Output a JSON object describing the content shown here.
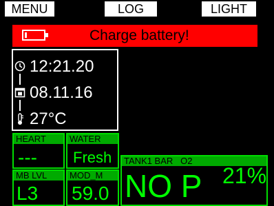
{
  "softkeys": {
    "menu": "MENU",
    "log": "LOG",
    "light": "LIGHT"
  },
  "alert": {
    "message": "Charge battery!",
    "icon": "battery-low-icon",
    "color": "#ff0000"
  },
  "info": {
    "time": "12:21.20",
    "date": "08.11.16",
    "temperature": "27°C"
  },
  "boxes": {
    "heart": {
      "label": "HEART",
      "value": "---"
    },
    "water": {
      "label": "WATER",
      "value": "Fresh"
    },
    "mb_level": {
      "label": "MB LVL",
      "value": "L3"
    },
    "mod": {
      "label": "MOD_M",
      "value": "59.0"
    },
    "tank": {
      "label": "TANK1 BAR   O2",
      "ndl": "NO P",
      "o2": "21%"
    }
  },
  "colors": {
    "accent_green": "#00ff00",
    "alert_red": "#ff0000"
  }
}
